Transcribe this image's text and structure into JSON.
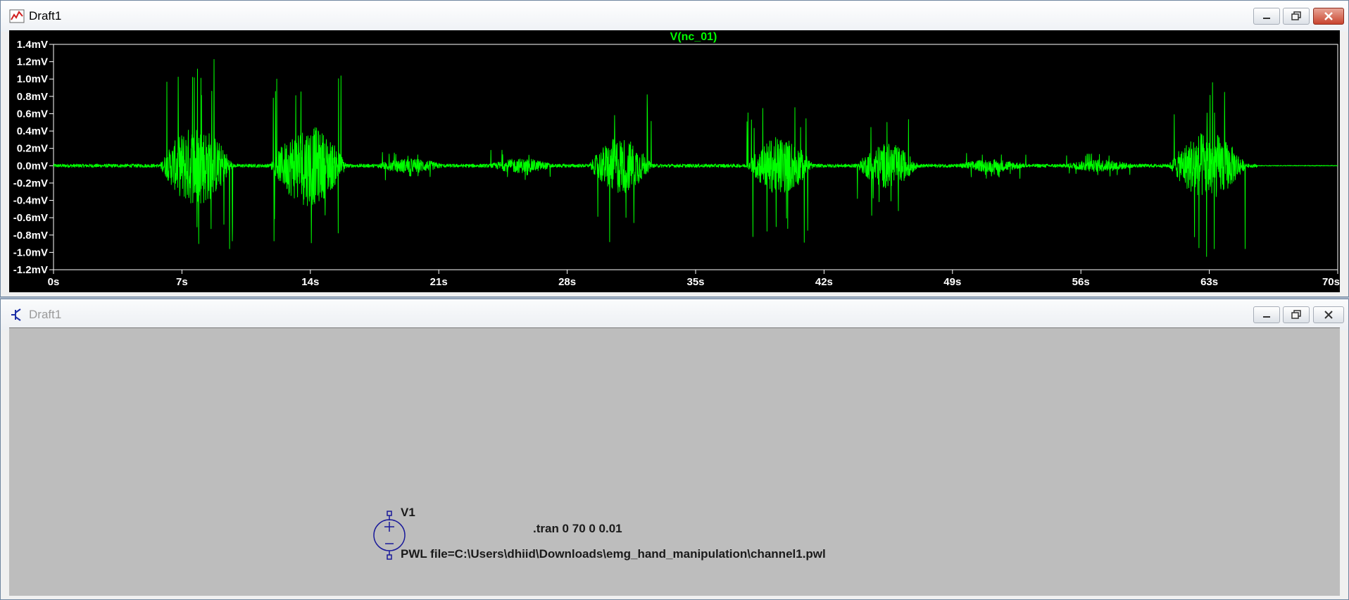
{
  "plot_window": {
    "title": "Draft1",
    "icons": {
      "app": "waveform-plot-icon",
      "minimize": "minimize-icon",
      "maximize": "maximize-icon",
      "close": "close-icon"
    }
  },
  "schematic_window": {
    "title": "Draft1",
    "icons": {
      "app": "schematic-transistor-icon",
      "minimize": "minimize-icon",
      "maximize": "maximize-icon",
      "close": "close-icon"
    },
    "component_name": "V1",
    "component_value": "PWL file=C:\\Users\\dhiid\\Downloads\\emg_hand_manipulation\\channel1.pwl",
    "directive": ".tran 0 70 0 0.01"
  },
  "colors": {
    "trace": "#00ff00",
    "plot_bg": "#000000",
    "axis_text": "#ffffff",
    "schematic_bg": "#bdbdbd",
    "symbol": "#1a1a9a"
  },
  "chart_data": {
    "type": "line",
    "title": "V(nc_01)",
    "xlabel": "",
    "ylabel": "",
    "xlim": [
      0,
      70
    ],
    "ylim": [
      -1.2,
      1.4
    ],
    "x_ticks": [
      "0s",
      "7s",
      "14s",
      "21s",
      "28s",
      "35s",
      "42s",
      "49s",
      "56s",
      "63s",
      "70s"
    ],
    "y_ticks": [
      "1.4mV",
      "1.2mV",
      "1.0mV",
      "0.8mV",
      "0.6mV",
      "0.4mV",
      "0.2mV",
      "0.0mV",
      "-0.2mV",
      "-0.4mV",
      "-0.6mV",
      "-0.8mV",
      "-1.0mV",
      "-1.2mV"
    ],
    "grid": false,
    "series": [
      {
        "baseline_noise_mV": 0.02,
        "trace_end_s": 70,
        "bursts": [
          {
            "start": 5.8,
            "end": 9.8,
            "peak_pos": 1.28,
            "peak_neg": -1.12
          },
          {
            "start": 11.8,
            "end": 16.0,
            "peak_pos": 1.27,
            "peak_neg": -0.93
          },
          {
            "start": 17.6,
            "end": 21.2,
            "peak_pos": 0.18,
            "peak_neg": -0.18
          },
          {
            "start": 23.8,
            "end": 27.2,
            "peak_pos": 0.18,
            "peak_neg": -0.17
          },
          {
            "start": 29.2,
            "end": 32.6,
            "peak_pos": 0.82,
            "peak_neg": -0.88
          },
          {
            "start": 37.8,
            "end": 41.4,
            "peak_pos": 0.69,
            "peak_neg": -0.9
          },
          {
            "start": 43.8,
            "end": 47.1,
            "peak_pos": 0.68,
            "peak_neg": -0.6
          },
          {
            "start": 49.3,
            "end": 53.0,
            "peak_pos": 0.15,
            "peak_neg": -0.15
          },
          {
            "start": 55.2,
            "end": 58.8,
            "peak_pos": 0.14,
            "peak_neg": -0.14
          },
          {
            "start": 60.8,
            "end": 65.0,
            "peak_pos": 0.98,
            "peak_neg": -1.07
          }
        ]
      }
    ]
  }
}
